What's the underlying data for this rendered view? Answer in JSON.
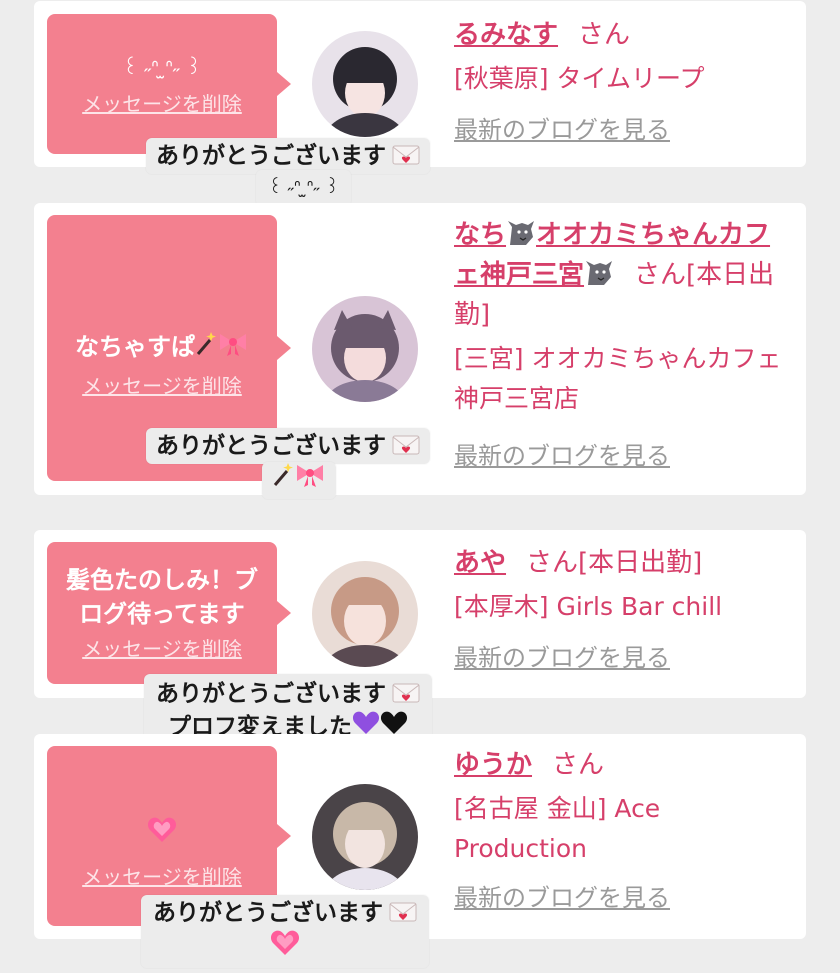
{
  "suffix_san": "さん",
  "delete_label": "メッセージを削除",
  "blog_label": "最新のブログを見る",
  "colors": {
    "bubble": "#f3808f",
    "name": "#d63f6a",
    "blog": "#9a9a9a",
    "background": "#ededed",
    "reply_bg": "#ececec"
  },
  "entries": [
    {
      "message": "꒰ ˶ᐢ ̫ᐢ˶ ꒱",
      "name": "るみなす",
      "status": "",
      "shop": "[秋葉原] タイムリープ",
      "reply_text": "ありがとうございます",
      "reply_extra": "꒰ ˶ᐢ ̫ᐢ˶ ꒱"
    },
    {
      "message": "なちゃすぱ",
      "message_icons": [
        "magic-wand-icon",
        "ribbon-icon"
      ],
      "name_part1": "なち",
      "name_part2": "オオカミちゃんカフェ神戸三宮",
      "name_icons": [
        "wolf-icon",
        "wolf-icon"
      ],
      "status": "[本日出勤]",
      "shop": "[三宮] オオカミちゃんカフェ神戸三宮店",
      "reply_text": "ありがとうございます",
      "reply_icons": [
        "magic-wand-icon",
        "ribbon-icon"
      ]
    },
    {
      "message": "髪色たのしみ！ブログ待ってます",
      "name": "あや",
      "status": "[本日出勤]",
      "shop": "[本厚木] Girls Bar chill",
      "reply_text": "ありがとうございます",
      "reply_extra": "プロフ変えました",
      "reply_icons": [
        "purple-heart-icon",
        "black-heart-icon"
      ]
    },
    {
      "message_icons": [
        "pink-heart-icon"
      ],
      "name": "ゆうか",
      "status": "",
      "shop": "[名古屋 金山] Ace Production",
      "reply_text": "ありがとうございます",
      "reply_icons": [
        "pink-heart-icon"
      ]
    }
  ]
}
